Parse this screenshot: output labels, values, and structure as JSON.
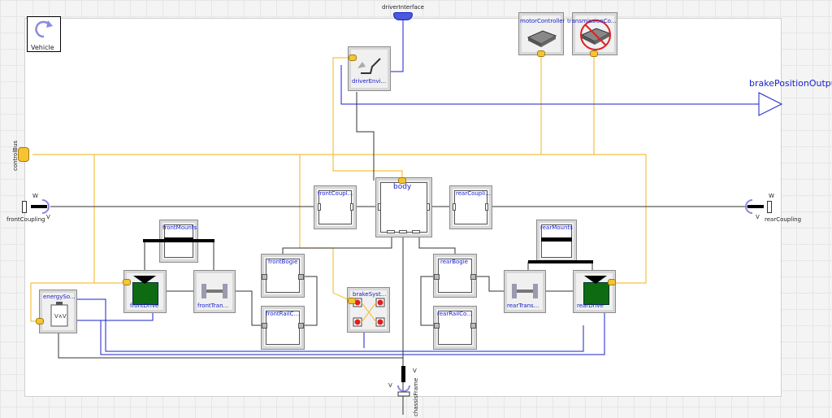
{
  "model": {
    "icon_label": "Vehicle",
    "connectors": {
      "driver_interface": "driverInterface",
      "control_bus": "controlBus",
      "front_coupling": "frontCoupling",
      "rear_coupling": "rearCoupling",
      "chassis_frame": "chassisFrame",
      "brake_output": "brakePositionOutput"
    },
    "components": {
      "motor_controller": "motorController",
      "transmission_controller": "transmissionCo...",
      "driver_environment": "driverEnvi...",
      "body": "body",
      "front_coupling_block": "frontCoupl...",
      "rear_coupling_block": "rearCoupli...",
      "front_mounts": "frontMounts",
      "rear_mounts": "rearMounts",
      "front_bogie": "frontBogie",
      "rear_bogie": "rearBogie",
      "front_rail_contact": "frontRailC...",
      "rear_rail_contact": "rearRailCo...",
      "brake_system": "brakeSyst...",
      "energy_source": "energySo...",
      "front_drive": "frontDrive",
      "rear_drive": "rearDrive",
      "front_transmission": "frontTran...",
      "rear_transmission": "rearTrans..."
    },
    "port_letters": {
      "w": "W",
      "v": "V"
    }
  },
  "colors": {
    "bus_line": "#f5c242",
    "signal_line": "#1a22c8",
    "mechanical_line": "#333333",
    "motor_green": "#0e6b12"
  }
}
